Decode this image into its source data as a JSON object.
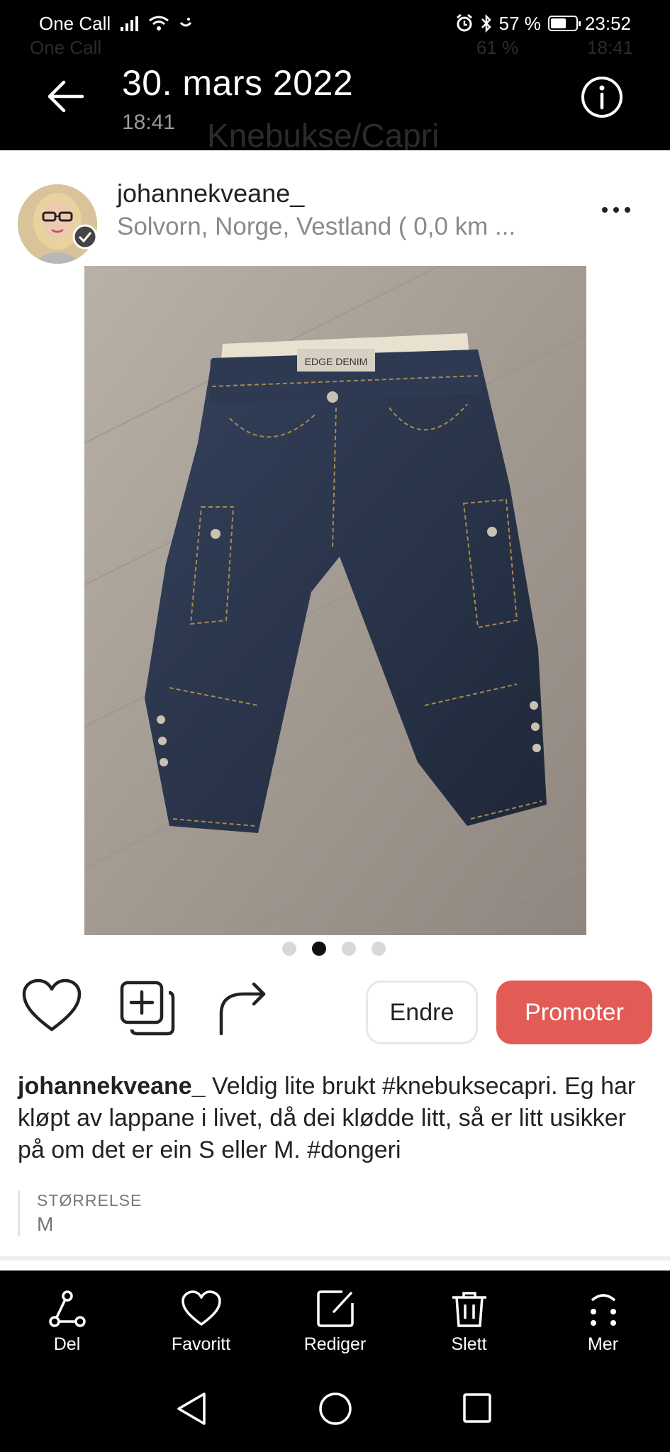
{
  "status_bar": {
    "carrier": "One Call",
    "battery": "57 %",
    "time": "23:52"
  },
  "header": {
    "date": "30. mars 2022",
    "time": "18:41",
    "ghost_carrier": "One Call",
    "ghost_battery": "61 %",
    "ghost_time": "18:41",
    "ghost_title": "Knebukse/Capri"
  },
  "post": {
    "username": "johannekveane_",
    "location": "Solvorn, Norge, Vestland ( 0,0 km ...",
    "image_count": 4,
    "active_image": 2,
    "caption_user": "johannekveane_",
    "caption_text": " Veldig lite brukt  #knebuksecapri. Eg har kløpt av lappane i livet, då dei klødde litt, så er litt usikker på om det er ein S eller M. #dongeri",
    "size_label": "STØRRELSE",
    "size_value": "M"
  },
  "actions": {
    "edit_label": "Endre",
    "promote_label": "Promoter",
    "promote_color": "#e35b55"
  },
  "bottom_bar": {
    "items": [
      {
        "label": "Del",
        "icon": "share-nodes-icon"
      },
      {
        "label": "Favoritt",
        "icon": "heart-icon"
      },
      {
        "label": "Rediger",
        "icon": "edit-icon"
      },
      {
        "label": "Slett",
        "icon": "trash-icon"
      },
      {
        "label": "Mer",
        "icon": "more-icon"
      }
    ]
  }
}
